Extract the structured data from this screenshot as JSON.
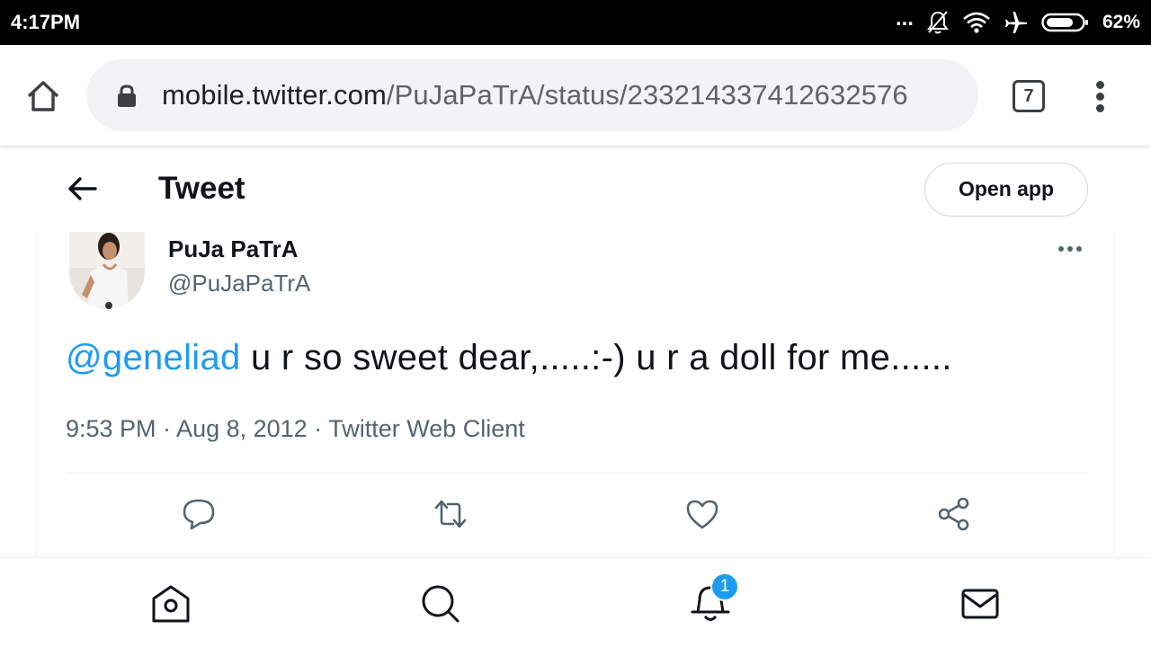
{
  "status_bar": {
    "time": "4:17PM",
    "more_indicator": "...",
    "icons": [
      "silent-bell-icon",
      "wifi-icon",
      "airplane-icon",
      "battery-icon"
    ],
    "battery_percent": "62%"
  },
  "browser": {
    "url_domain": "mobile.twitter.com",
    "url_path": "/PuJaPaTrA/status/23321433741263257​6",
    "tab_count": "7",
    "icons": [
      "home-icon",
      "lock-icon",
      "overflow-menu-icon"
    ]
  },
  "twitter_header": {
    "title": "Tweet",
    "open_app_label": "Open app"
  },
  "tweet": {
    "author_name": "PuJa PaTrA",
    "author_handle": "@PuJaPaTrA",
    "mention": "@geneliad",
    "text": " u r so sweet dear,.....:-) u r a doll for me......",
    "meta": "9:53 PM · Aug 8, 2012 · Twitter Web Client",
    "actions": [
      "reply-icon",
      "retweet-icon",
      "like-icon",
      "share-icon"
    ]
  },
  "bottom_nav": {
    "items": [
      "home-icon",
      "search-icon",
      "notifications-icon",
      "messages-icon"
    ],
    "notification_badge": "1"
  },
  "colors": {
    "accent": "#1d9bf0",
    "text_primary": "#0f1419",
    "text_secondary": "#536471"
  }
}
